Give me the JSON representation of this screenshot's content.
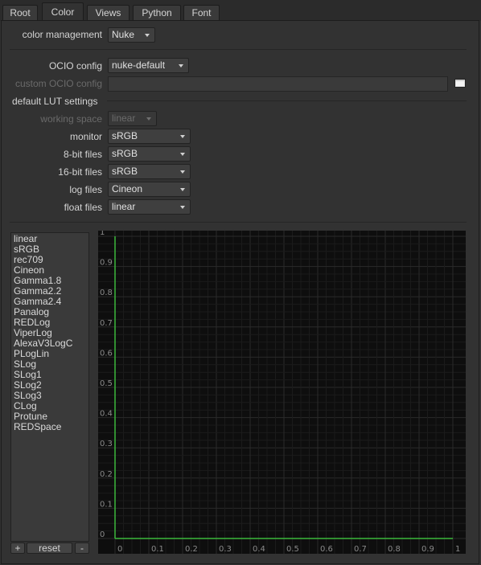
{
  "tabs": [
    {
      "label": "Root",
      "active": false
    },
    {
      "label": "Color",
      "active": true
    },
    {
      "label": "Views",
      "active": false
    },
    {
      "label": "Python",
      "active": false
    },
    {
      "label": "Font",
      "active": false
    }
  ],
  "color_management": {
    "label": "color management",
    "value": "Nuke"
  },
  "ocio_config": {
    "label": "OCIO config",
    "value": "nuke-default"
  },
  "custom_ocio_config": {
    "label": "custom OCIO config",
    "value": ""
  },
  "default_lut_settings": {
    "label": "default LUT settings"
  },
  "working_space": {
    "label": "working space",
    "value": "linear"
  },
  "monitor": {
    "label": "monitor",
    "value": "sRGB"
  },
  "bit8_files": {
    "label": "8-bit files",
    "value": "sRGB"
  },
  "bit16_files": {
    "label": "16-bit files",
    "value": "sRGB"
  },
  "log_files": {
    "label": "log files",
    "value": "Cineon"
  },
  "float_files": {
    "label": "float files",
    "value": "linear"
  },
  "lut_list": [
    "linear",
    "sRGB",
    "rec709",
    "Cineon",
    "Gamma1.8",
    "Gamma2.2",
    "Gamma2.4",
    "Panalog",
    "REDLog",
    "ViperLog",
    "AlexaV3LogC",
    "PLogLin",
    "SLog",
    "SLog1",
    "SLog2",
    "SLog3",
    "CLog",
    "Protune",
    "REDSpace"
  ],
  "list_buttons": {
    "add": "+",
    "reset": "reset",
    "remove": "-"
  },
  "colors": {
    "curve": "#3cb83c",
    "grid": "#2a2a2a",
    "graph_bg": "#0e0e0e"
  },
  "chart_data": {
    "type": "line",
    "title": "",
    "xlabel": "",
    "ylabel": "",
    "xlim": [
      0,
      1
    ],
    "ylim": [
      0,
      1
    ],
    "x_ticks": [
      "0",
      "0.1",
      "0.2",
      "0.3",
      "0.4",
      "0.5",
      "0.6",
      "0.7",
      "0.8",
      "0.9",
      "1"
    ],
    "y_ticks": [
      "0",
      "0.1",
      "0.2",
      "0.3",
      "0.4",
      "0.5",
      "0.6",
      "0.7",
      "0.8",
      "0.9",
      "1"
    ],
    "grid": true,
    "series": [
      {
        "x": [
          0,
          0,
          0
        ],
        "y": [
          0,
          0.5,
          1
        ]
      },
      {
        "x": [
          0,
          0.5,
          1
        ],
        "y": [
          0,
          0,
          0
        ]
      }
    ]
  }
}
